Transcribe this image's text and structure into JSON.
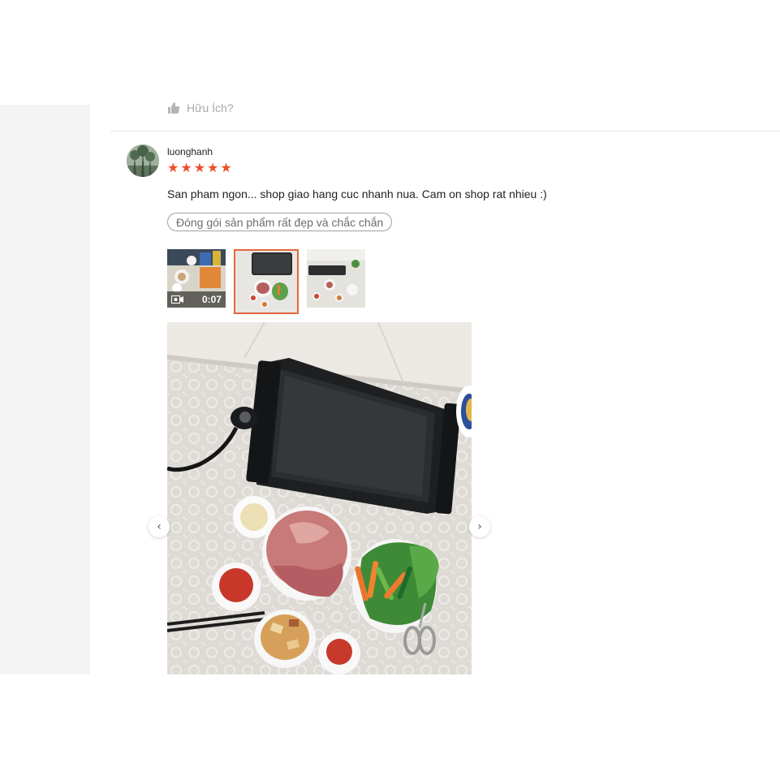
{
  "helpful": {
    "label": "Hữu Ích?",
    "icon": "thumbs-up-icon"
  },
  "review": {
    "username": "luonghanh",
    "rating": 5,
    "stars": [
      "★",
      "★",
      "★",
      "★",
      "★"
    ],
    "comment": "San pham ngon... shop giao hang cuc nhanh nua. Cam on shop rat nhieu :)",
    "tag": "Đóng gói sản phẩm rất đẹp và chắc chắn",
    "media": [
      {
        "type": "video",
        "duration": "0:07",
        "icon": "video-camera-icon"
      },
      {
        "type": "image",
        "selected": true
      },
      {
        "type": "image"
      }
    ]
  },
  "gallery": {
    "prev_icon": "‹",
    "next_icon": "›"
  },
  "colors": {
    "accent": "#ee4d2d",
    "selected_border": "#e5673e",
    "side_panel": "#f4f4f4"
  }
}
